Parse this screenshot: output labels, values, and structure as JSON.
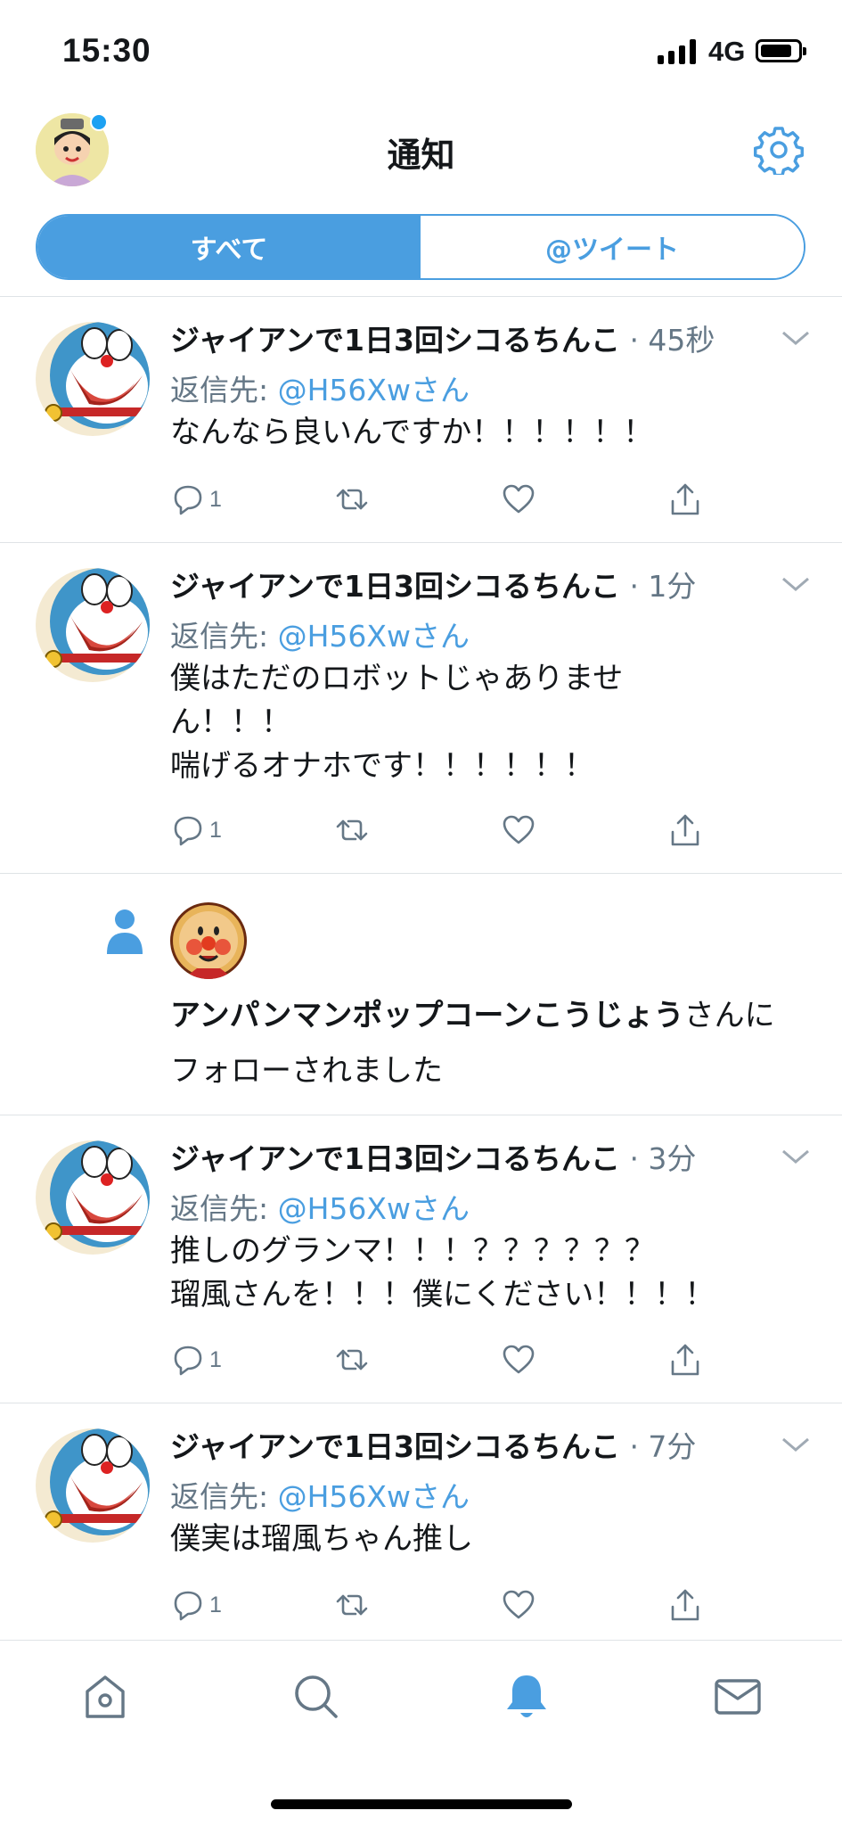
{
  "status_bar": {
    "time": "15:30",
    "network": "4G"
  },
  "header": {
    "title": "通知"
  },
  "tabs": [
    {
      "label": "すべて",
      "active": true
    },
    {
      "label": "@ツイート",
      "active": false
    }
  ],
  "notifications": [
    {
      "type": "reply",
      "name": "ジャイアンで1日3回シコるちんこ",
      "time": "· 45秒",
      "reply_prefix": "返信先: ",
      "reply_handle": "@H56Xwさん",
      "text": "なんなら良いんですか！！！！！！",
      "reply_count": "1"
    },
    {
      "type": "reply",
      "name": "ジャイアンで1日3回シコるちんこ",
      "time": "· 1分",
      "reply_prefix": "返信先: ",
      "reply_handle": "@H56Xwさん",
      "text": "僕はただのロボットじゃありませ\nん！！！\n喘げるオナホです！！！！！！",
      "reply_count": "1"
    },
    {
      "type": "follow",
      "follower_name": "アンパンマンポップコーンこうじょう",
      "suffix": "さんに",
      "line2": "フォローされました"
    },
    {
      "type": "reply",
      "name": "ジャイアンで1日3回シコるちんこ",
      "time": "· 3分",
      "reply_prefix": "返信先: ",
      "reply_handle": "@H56Xwさん",
      "text": "推しのグランマ！！！？？？？？？\n瑠風さんを！！！僕にください！！！！",
      "reply_count": "1"
    },
    {
      "type": "reply",
      "name": "ジャイアンで1日3回シコるちんこ",
      "time": "· 7分",
      "reply_prefix": "返信先: ",
      "reply_handle": "@H56Xwさん",
      "text": "僕実は瑠風ちゃん推し",
      "reply_count": "1"
    }
  ],
  "bottom_nav": [
    {
      "icon": "home-icon",
      "active": false
    },
    {
      "icon": "search-icon",
      "active": false
    },
    {
      "icon": "bell-icon",
      "active": true
    },
    {
      "icon": "mail-icon",
      "active": false
    }
  ],
  "colors": {
    "accent": "#4a9ee0",
    "secondary_text": "#657786",
    "divider": "#dfe3e6"
  }
}
